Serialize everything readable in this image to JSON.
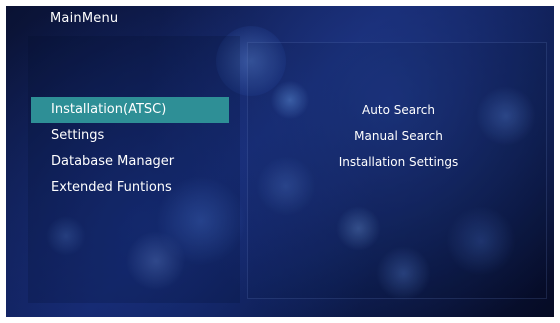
{
  "header": {
    "title": "MainMenu"
  },
  "menu": {
    "items": [
      {
        "label": "Installation(ATSC)",
        "selected": true
      },
      {
        "label": "Settings",
        "selected": false
      },
      {
        "label": "Database Manager",
        "selected": false
      },
      {
        "label": "Extended Funtions",
        "selected": false
      }
    ]
  },
  "submenu": {
    "items": [
      {
        "label": "Auto Search"
      },
      {
        "label": "Manual Search"
      },
      {
        "label": "Installation Settings"
      }
    ]
  },
  "colors": {
    "selection": "#2e8f96",
    "text": "#ffffff",
    "background": "#0c1a4a"
  }
}
